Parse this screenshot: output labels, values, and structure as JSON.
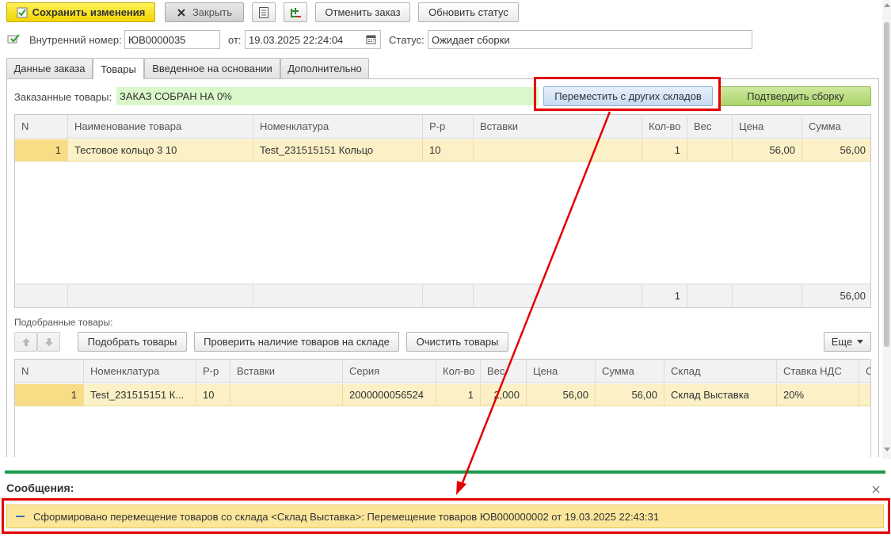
{
  "toolbar": {
    "save_label": "Сохранить изменения",
    "close_label": "Закрыть",
    "cancel_order_label": "Отменить заказ",
    "update_status_label": "Обновить статус"
  },
  "header": {
    "internal_number_label": "Внутренний номер:",
    "internal_number_value": "ЮВ0000035",
    "date_label": "от:",
    "date_value": "19.03.2025 22:24:04",
    "status_label": "Статус:",
    "status_value": "Ожидает сборки"
  },
  "tabs": [
    {
      "label": "Данные заказа",
      "active": false
    },
    {
      "label": "Товары",
      "active": true
    },
    {
      "label": "Введенное на основании",
      "active": false
    },
    {
      "label": "Дополнительно",
      "active": false
    }
  ],
  "ordered": {
    "label": "Заказанные товары:",
    "status_text": "ЗАКАЗ СОБРАН НА 0%",
    "move_button_label": "Переместить с других складов",
    "confirm_button_label": "Подтвердить сборку",
    "columns": [
      "N",
      "Наименование товара",
      "Номенклатура",
      "Р-р",
      "Вставки",
      "Кол-во",
      "Вес",
      "Цена",
      "Сумма"
    ],
    "rows": [
      [
        "1",
        "Тестовое кольцо 3 10",
        "Test_231515151 Кольцо",
        "10",
        "",
        "1",
        "",
        "56,00",
        "56,00"
      ]
    ],
    "totals": {
      "qty": "1",
      "sum": "56,00"
    }
  },
  "picked": {
    "label": "Подобранные товары:",
    "pick_button_label": "Подобрать товары",
    "check_button_label": "Проверить наличие товаров на складе",
    "clear_button_label": "Очистить товары",
    "more_button_label": "Еще",
    "columns": [
      "N",
      "Номенклатура",
      "Р-р",
      "Вставки",
      "Серия",
      "Кол-во",
      "Вес",
      "Цена",
      "Сумма",
      "Склад",
      "Ставка НДС",
      "С"
    ],
    "rows": [
      [
        "1",
        "Test_231515151 К...",
        "10",
        "",
        "2000000056524",
        "1",
        "2,000",
        "56,00",
        "56,00",
        "Склад Выставка",
        "20%",
        ""
      ]
    ]
  },
  "messages": {
    "title": "Сообщения:",
    "items": [
      "Сформировано перемещение товаров со склада <Склад Выставка>: Перемещение товаров ЮВ000000002 от 19.03.2025 22:43:31"
    ]
  },
  "colors": {
    "save_button": "#f2d500",
    "selected_row": "#fbf0c6",
    "status_bar": "#d9f7c9",
    "highlight_frame": "#e30000",
    "messages_divider": "#1b9a4a",
    "message_bg": "#fbe69a"
  },
  "icons": [
    "check-doc-icon",
    "close-x-icon",
    "report-icon",
    "add-structure-icon",
    "calendar-icon",
    "arrow-up-icon",
    "arrow-down-icon",
    "dropdown-icon",
    "collapse-icon",
    "close-icon"
  ]
}
